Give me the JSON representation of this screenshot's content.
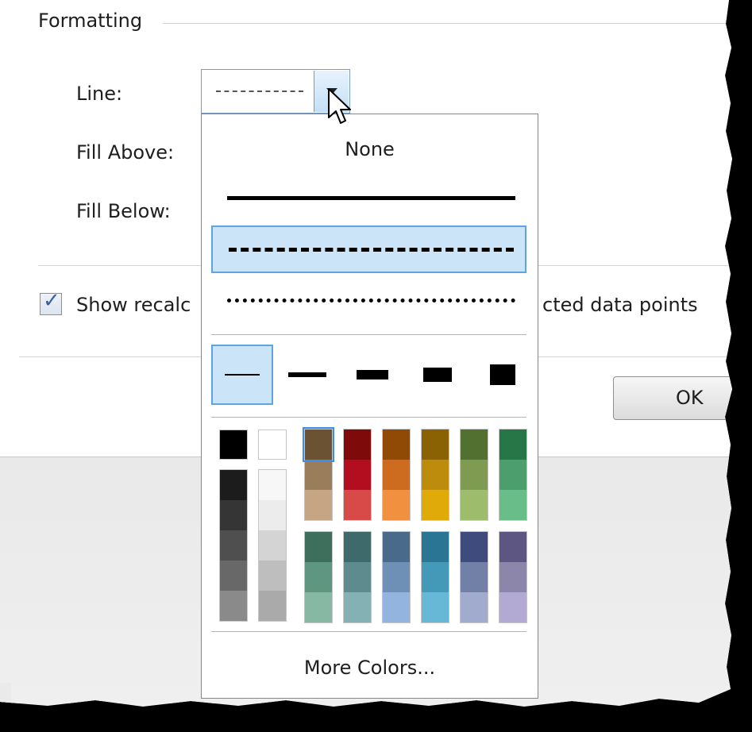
{
  "group": {
    "title": "Formatting"
  },
  "fields": {
    "line_label": "Line:",
    "fill_above_label": "Fill Above:",
    "fill_below_label": "Fill Below:"
  },
  "checkbox": {
    "checked": true,
    "label_start": "Show recalc",
    "label_end": "cted data points"
  },
  "ok_button": "OK",
  "popup": {
    "none_label": "None",
    "line_styles": [
      "solid",
      "dashed",
      "dotted"
    ],
    "selected_style": "dashed",
    "line_weights": [
      "hairline",
      "thin",
      "medium",
      "thick",
      "heavy"
    ],
    "selected_weight": "hairline",
    "colors": {
      "black_white": [
        "#000000",
        "#ffffff"
      ],
      "gray_dark": [
        "#1c1c1c",
        "#353535",
        "#4f4f4f",
        "#686868",
        "#8a8a8a"
      ],
      "gray_light": [
        "#f7f7f7",
        "#ececec",
        "#d4d4d4",
        "#bebebe",
        "#aaaaaa"
      ],
      "upper_palette": [
        [
          "#6b5233",
          "#9a7e5c",
          "#c6a584"
        ],
        [
          "#7e0a0a",
          "#b30d20",
          "#d84a48"
        ],
        [
          "#914a05",
          "#cd6c1f",
          "#f19140"
        ],
        [
          "#8a6204",
          "#bd8c0c",
          "#e0ab08"
        ],
        [
          "#52702f",
          "#7e9b51",
          "#9dbd6c"
        ],
        [
          "#267647",
          "#4c9e6d",
          "#69bd88"
        ]
      ],
      "lower_palette": [
        [
          "#3e6f5c",
          "#5e9681",
          "#86b8a4"
        ],
        [
          "#3e6a6b",
          "#5e8b8d",
          "#84b1b4"
        ],
        [
          "#4a6a8c",
          "#6e90b7",
          "#93b4de"
        ],
        [
          "#2a7593",
          "#4599b8",
          "#66b8d6"
        ],
        [
          "#3e4b7c",
          "#7280a8",
          "#a0abcd"
        ],
        [
          "#5e5682",
          "#8c86aa",
          "#b2aad2"
        ]
      ],
      "selected_color": "#6b5233"
    },
    "more_colors_label": "More Colors..."
  }
}
